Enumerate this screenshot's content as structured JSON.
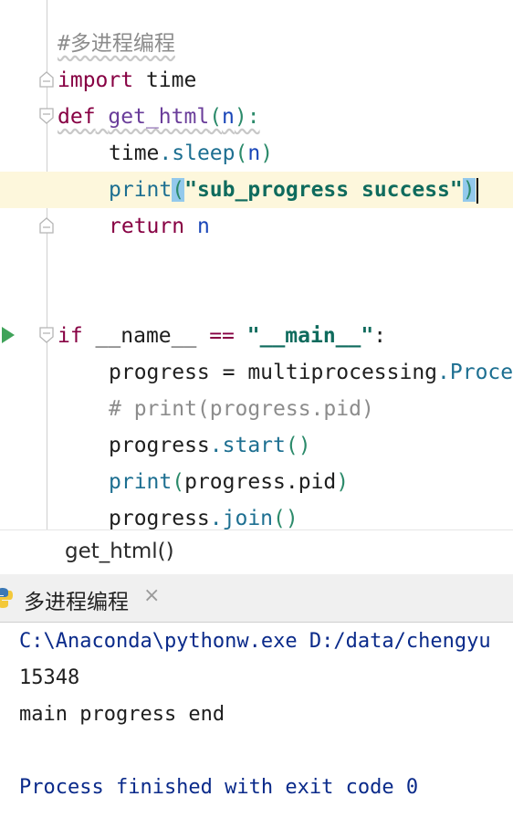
{
  "editor": {
    "comment_title": "#多进程编程",
    "l_import_kw": "import",
    "l_import_mod": " time",
    "l_def_kw": "def",
    "l_def_name": "get_html",
    "l_def_open": "(",
    "l_def_arg": "n",
    "l_def_close": "):",
    "l_sleep_obj": "time",
    "l_sleep_dot": ".",
    "l_sleep_fn": "sleep",
    "l_sleep_open": "(",
    "l_sleep_arg": "n",
    "l_sleep_close": ")",
    "l_print_fn": "print",
    "l_print_open": "(",
    "l_print_str": "\"sub_progress success\"",
    "l_print_close": ")",
    "l_return_kw": "return",
    "l_return_val": " n",
    "l_if_kw": "if",
    "l_if_name": " __name__ ",
    "l_if_eq": "==",
    "l_if_sp": " ",
    "l_if_str": "\"__main__\"",
    "l_if_colon": ":",
    "l_prog_var": "progress = multiprocessing",
    "l_prog_dot": ".",
    "l_prog_cls": "Proce",
    "l_cmt_pid": "# print(progress.pid)",
    "l_start_var": "progress",
    "l_start_dot": ".",
    "l_start_fn": "start",
    "l_start_par": "()",
    "l_ppid_fn": "print",
    "l_ppid_open": "(",
    "l_ppid_inner": "progress.pid",
    "l_ppid_close": ")",
    "l_join_var": "progress",
    "l_join_dot": ".",
    "l_join_fn": "join",
    "l_join_par": "()"
  },
  "breadcrumb": {
    "text": "get_html()"
  },
  "run_tab": {
    "label": "多进程编程",
    "close": "×"
  },
  "console": {
    "lines": [
      "C:\\Anaconda\\pythonw.exe D:/data/chengyu",
      "15348",
      "main progress end",
      "",
      "Process finished with exit code 0"
    ]
  },
  "colors": {
    "keyword": "#870043",
    "function": "#1d6f91",
    "string": "#0f6b5d",
    "current_line": "#fdf7dc",
    "console_command": "#0a2a8a"
  },
  "icons": [
    "fold-marker-icon",
    "run-arrow-icon",
    "python-icon",
    "close-icon"
  ]
}
